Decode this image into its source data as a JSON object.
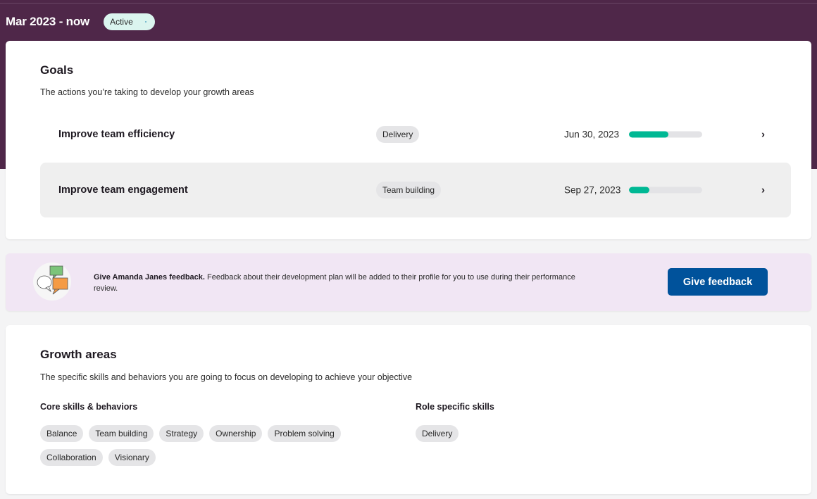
{
  "header": {
    "period": "Mar 2023 - now",
    "status": "Active"
  },
  "goals": {
    "title": "Goals",
    "subtitle": "The actions you’re taking to develop your growth areas",
    "items": [
      {
        "name": "Improve team efficiency",
        "tag": "Delivery",
        "due": "Jun 30, 2023",
        "progress_percent": 54
      },
      {
        "name": "Improve team engagement",
        "tag": "Team building",
        "due": "Sep 27, 2023",
        "progress_percent": 28
      }
    ],
    "chevron_icon": "›"
  },
  "feedback": {
    "icon": "speech-bubbles-icon",
    "bold": "Give Amanda Janes feedback.",
    "text": " Feedback about their development plan will be added to their profile for you to use during their performance review.",
    "button_label": "Give feedback"
  },
  "growth": {
    "title": "Growth areas",
    "subtitle": "The specific skills and behaviors you are going to focus on developing to achieve your objective",
    "core": {
      "heading": "Core skills & behaviors",
      "skills": [
        "Balance",
        "Team building",
        "Strategy",
        "Ownership",
        "Problem solving",
        "Collaboration",
        "Visionary"
      ]
    },
    "role": {
      "heading": "Role specific skills",
      "skills": [
        "Delivery"
      ]
    }
  },
  "colors": {
    "header_bg": "#4f2749",
    "status_badge_bg": "#dbf5ef",
    "progress_fill": "#00b894",
    "button_bg": "#00529b",
    "banner_bg": "#f1e6f4"
  }
}
